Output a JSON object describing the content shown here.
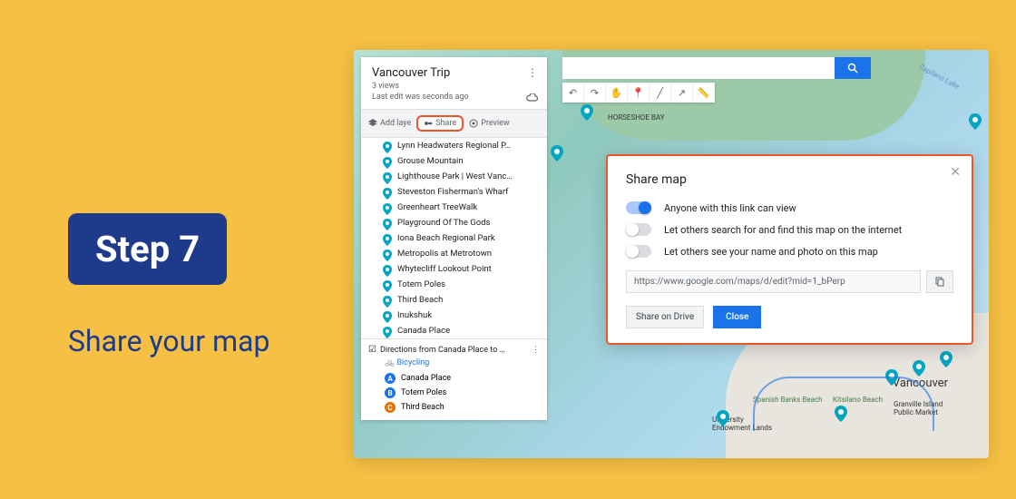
{
  "step": {
    "label": "Step 7",
    "caption": "Share your map"
  },
  "sidebar": {
    "title": "Vancouver Trip",
    "views": "3 views",
    "last_edit": "Last edit was seconds ago",
    "add_layer": "Add laye",
    "share": "Share",
    "preview": "Preview",
    "items": [
      "Lynn Headwaters Regional P…",
      "Grouse Mountain",
      "Lighthouse Park | West Vanc…",
      "Steveston Fisherman's Wharf",
      "Greenheart TreeWalk",
      "Playground Of The Gods",
      "Iona Beach Regional Park",
      "Metropolis at Metrotown",
      "Whytecliff Lookout Point",
      "Totem Poles",
      "Third Beach",
      "Inukshuk",
      "Canada Place"
    ],
    "directions_title": "Directions from Canada Place to …",
    "mode": "Bicycling",
    "stops": [
      {
        "letter": "A",
        "color": "#1a73e8",
        "label": "Canada Place"
      },
      {
        "letter": "B",
        "color": "#1a73e8",
        "label": "Totem Poles"
      },
      {
        "letter": "C",
        "color": "#e37400",
        "label": "Third Beach"
      }
    ]
  },
  "dialog": {
    "title": "Share map",
    "opt1": "Anyone with this link can view",
    "opt2": "Let others search for and find this map on the internet",
    "opt3": "Let others see your name and photo on this map",
    "url": "https://www.google.com/maps/d/edit?mid=1_bPerp",
    "share_drive": "Share on Drive",
    "close": "Close"
  },
  "map_labels": {
    "horseshoe": "HORSESHOE BAY",
    "capilano": "Capilano Lake",
    "vancouver": "Vancouver",
    "spanish": "Spanish Banks Beach",
    "kitsilano": "Kitsilano Beach",
    "university": "University Endowment Lands",
    "granville": "Granville Island Public Market"
  }
}
